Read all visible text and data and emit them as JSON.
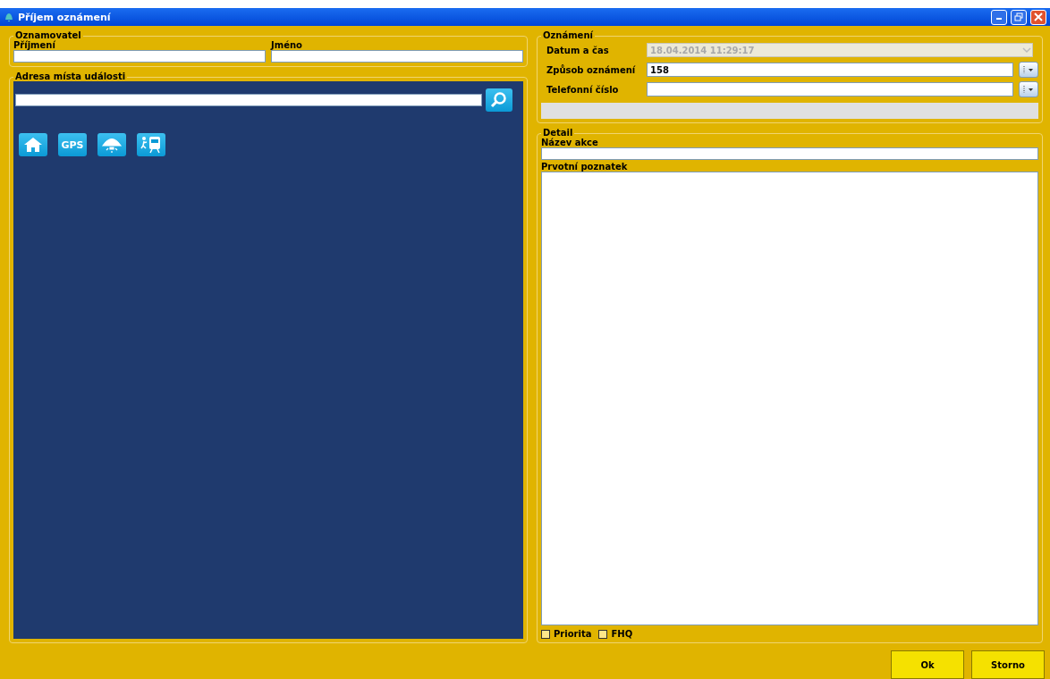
{
  "window": {
    "title": "Příjem oznámení"
  },
  "reporter": {
    "legend": "Oznamovatel",
    "fields": [
      {
        "label": "Příjmení"
      },
      {
        "label": "Jméno"
      }
    ]
  },
  "address": {
    "legend": "Adresa místa události",
    "tools": [
      {
        "kind": "home"
      },
      {
        "kind": "gps",
        "label": "GPS"
      },
      {
        "kind": "lamp"
      },
      {
        "kind": "train"
      }
    ]
  },
  "notice": {
    "legend": "Oznámení",
    "rows": [
      {
        "kind": "date",
        "label": "Datum a čas",
        "value": "18.04.2014 11:29:17",
        "disabled": true
      },
      {
        "kind": "combo",
        "label": "Způsob oznámení",
        "value": "158",
        "disabled": false
      },
      {
        "kind": "combo",
        "label": "Telefonní číslo",
        "disabled": false
      }
    ]
  },
  "detail": {
    "legend": "Detail",
    "name_label": "Název akce",
    "note_label": "Prvotní poznatek",
    "checkboxes": [
      {
        "label": "Priorita",
        "checked": false
      },
      {
        "label": "FHQ",
        "checked": false
      }
    ]
  },
  "buttons": [
    {
      "label": "Ok"
    },
    {
      "label": "Storno"
    }
  ]
}
